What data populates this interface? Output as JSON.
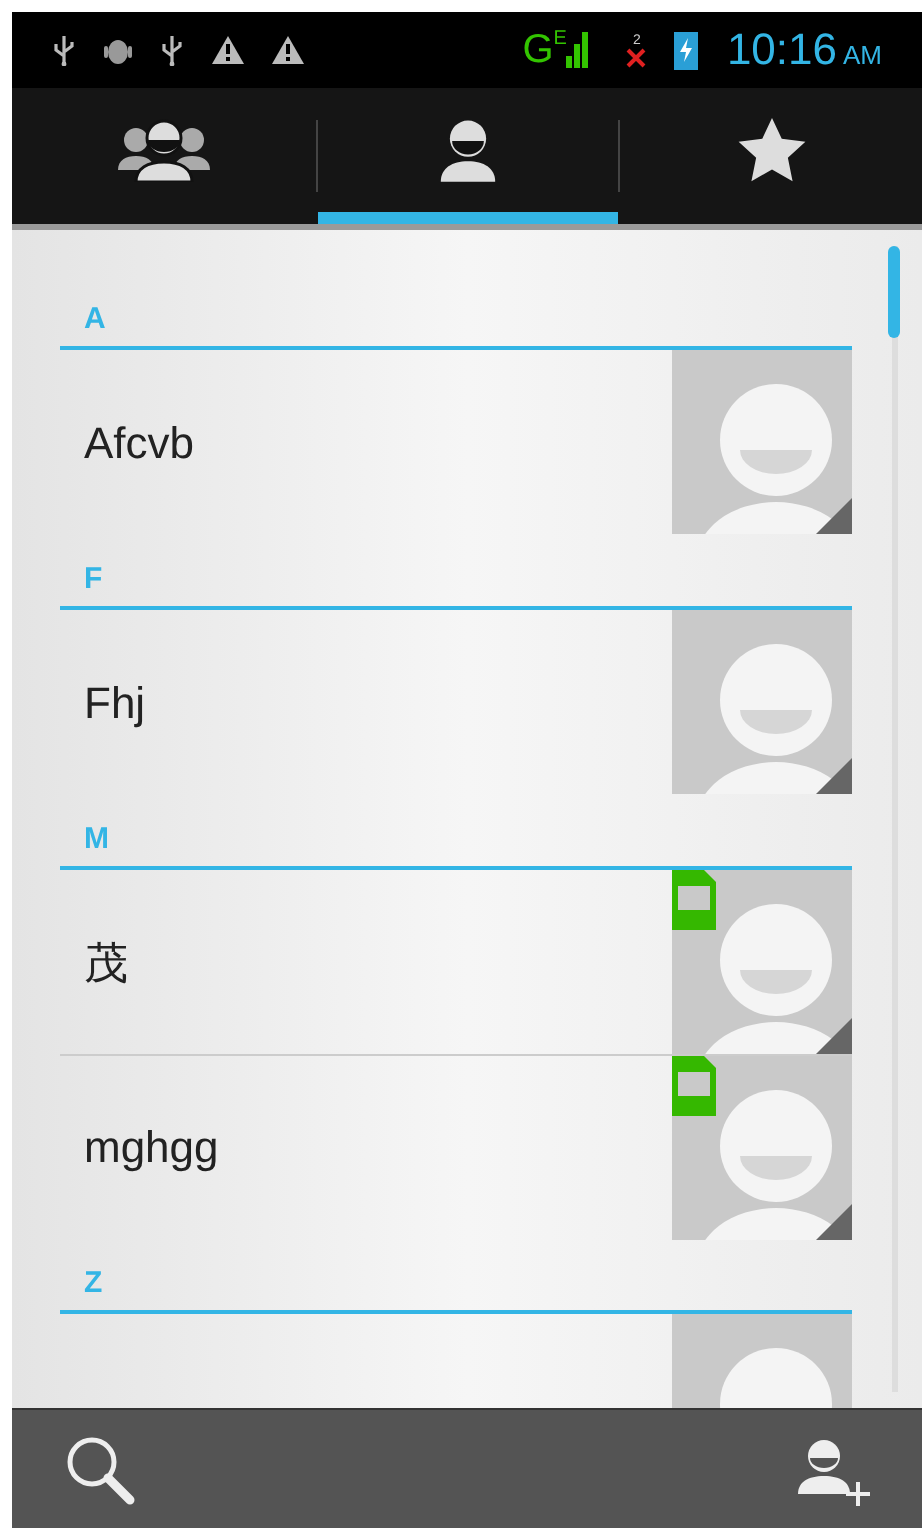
{
  "status_bar": {
    "network": "G",
    "network_sub": "E",
    "missed_calls": "2",
    "time": "10:16",
    "meridiem": "AM"
  },
  "tabs": [
    {
      "kind": "groups",
      "selected": false
    },
    {
      "kind": "contacts",
      "selected": true
    },
    {
      "kind": "favorites",
      "selected": false
    }
  ],
  "sections": [
    {
      "letter": "A",
      "contacts": [
        {
          "name": "Afcvb",
          "sim": false
        }
      ]
    },
    {
      "letter": "F",
      "contacts": [
        {
          "name": "Fhj",
          "sim": false
        }
      ]
    },
    {
      "letter": "M",
      "contacts": [
        {
          "name": "茂",
          "sim": true
        },
        {
          "name": "mghgg",
          "sim": true
        }
      ]
    },
    {
      "letter": "Z",
      "contacts": [
        {
          "sim": false
        }
      ]
    }
  ]
}
